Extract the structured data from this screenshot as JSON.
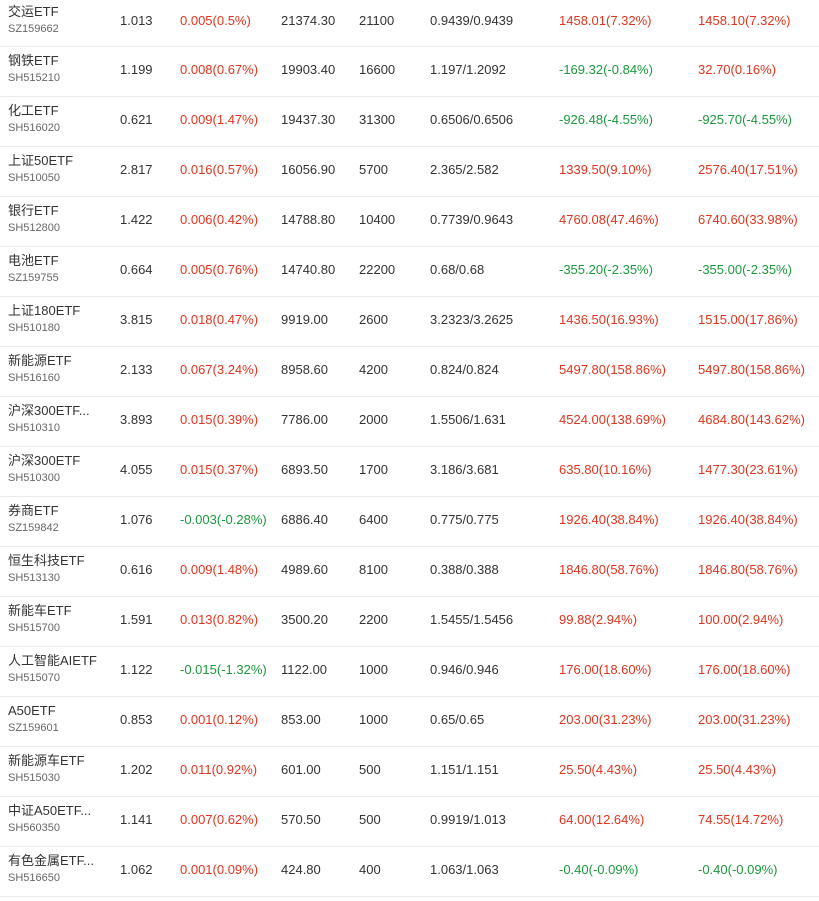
{
  "colors": {
    "up": "#e0341d",
    "down": "#1b9a3c",
    "text": "#333333",
    "sub_text": "#666666",
    "divider": "#ebebeb"
  },
  "rows": [
    {
      "name": "交运ETF",
      "code": "SZ159662",
      "price": "1.013",
      "change": "0.005(0.5%)",
      "change_dir": "up",
      "market_value": "21374.30",
      "quantity": "21100",
      "cost": "0.9439/0.9439",
      "pl_day": "1458.01(7.32%)",
      "pl_day_dir": "up",
      "pl_total": "1458.10(7.32%)",
      "pl_total_dir": "up"
    },
    {
      "name": "钢铁ETF",
      "code": "SH515210",
      "price": "1.199",
      "change": "0.008(0.67%)",
      "change_dir": "up",
      "market_value": "19903.40",
      "quantity": "16600",
      "cost": "1.197/1.2092",
      "pl_day": "-169.32(-0.84%)",
      "pl_day_dir": "down",
      "pl_total": "32.70(0.16%)",
      "pl_total_dir": "up"
    },
    {
      "name": "化工ETF",
      "code": "SH516020",
      "price": "0.621",
      "change": "0.009(1.47%)",
      "change_dir": "up",
      "market_value": "19437.30",
      "quantity": "31300",
      "cost": "0.6506/0.6506",
      "pl_day": "-926.48(-4.55%)",
      "pl_day_dir": "down",
      "pl_total": "-925.70(-4.55%)",
      "pl_total_dir": "down"
    },
    {
      "name": "上证50ETF",
      "code": "SH510050",
      "price": "2.817",
      "change": "0.016(0.57%)",
      "change_dir": "up",
      "market_value": "16056.90",
      "quantity": "5700",
      "cost": "2.365/2.582",
      "pl_day": "1339.50(9.10%)",
      "pl_day_dir": "up",
      "pl_total": "2576.40(17.51%)",
      "pl_total_dir": "up"
    },
    {
      "name": "银行ETF",
      "code": "SH512800",
      "price": "1.422",
      "change": "0.006(0.42%)",
      "change_dir": "up",
      "market_value": "14788.80",
      "quantity": "10400",
      "cost": "0.7739/0.9643",
      "pl_day": "4760.08(47.46%)",
      "pl_day_dir": "up",
      "pl_total": "6740.60(33.98%)",
      "pl_total_dir": "up"
    },
    {
      "name": "电池ETF",
      "code": "SZ159755",
      "price": "0.664",
      "change": "0.005(0.76%)",
      "change_dir": "up",
      "market_value": "14740.80",
      "quantity": "22200",
      "cost": "0.68/0.68",
      "pl_day": "-355.20(-2.35%)",
      "pl_day_dir": "down",
      "pl_total": "-355.00(-2.35%)",
      "pl_total_dir": "down"
    },
    {
      "name": "上证180ETF",
      "code": "SH510180",
      "price": "3.815",
      "change": "0.018(0.47%)",
      "change_dir": "up",
      "market_value": "9919.00",
      "quantity": "2600",
      "cost": "3.2323/3.2625",
      "pl_day": "1436.50(16.93%)",
      "pl_day_dir": "up",
      "pl_total": "1515.00(17.86%)",
      "pl_total_dir": "up"
    },
    {
      "name": "新能源ETF",
      "code": "SH516160",
      "price": "2.133",
      "change": "0.067(3.24%)",
      "change_dir": "up",
      "market_value": "8958.60",
      "quantity": "4200",
      "cost": "0.824/0.824",
      "pl_day": "5497.80(158.86%)",
      "pl_day_dir": "up",
      "pl_total": "5497.80(158.86%)",
      "pl_total_dir": "up"
    },
    {
      "name": "沪深300ETF...",
      "code": "SH510310",
      "price": "3.893",
      "change": "0.015(0.39%)",
      "change_dir": "up",
      "market_value": "7786.00",
      "quantity": "2000",
      "cost": "1.5506/1.631",
      "pl_day": "4524.00(138.69%)",
      "pl_day_dir": "up",
      "pl_total": "4684.80(143.62%)",
      "pl_total_dir": "up"
    },
    {
      "name": "沪深300ETF",
      "code": "SH510300",
      "price": "4.055",
      "change": "0.015(0.37%)",
      "change_dir": "up",
      "market_value": "6893.50",
      "quantity": "1700",
      "cost": "3.186/3.681",
      "pl_day": "635.80(10.16%)",
      "pl_day_dir": "up",
      "pl_total": "1477.30(23.61%)",
      "pl_total_dir": "up"
    },
    {
      "name": "券商ETF",
      "code": "SZ159842",
      "price": "1.076",
      "change": "-0.003(-0.28%)",
      "change_dir": "down",
      "market_value": "6886.40",
      "quantity": "6400",
      "cost": "0.775/0.775",
      "pl_day": "1926.40(38.84%)",
      "pl_day_dir": "up",
      "pl_total": "1926.40(38.84%)",
      "pl_total_dir": "up"
    },
    {
      "name": "恒生科技ETF",
      "code": "SH513130",
      "price": "0.616",
      "change": "0.009(1.48%)",
      "change_dir": "up",
      "market_value": "4989.60",
      "quantity": "8100",
      "cost": "0.388/0.388",
      "pl_day": "1846.80(58.76%)",
      "pl_day_dir": "up",
      "pl_total": "1846.80(58.76%)",
      "pl_total_dir": "up"
    },
    {
      "name": "新能车ETF",
      "code": "SH515700",
      "price": "1.591",
      "change": "0.013(0.82%)",
      "change_dir": "up",
      "market_value": "3500.20",
      "quantity": "2200",
      "cost": "1.5455/1.5456",
      "pl_day": "99.88(2.94%)",
      "pl_day_dir": "up",
      "pl_total": "100.00(2.94%)",
      "pl_total_dir": "up"
    },
    {
      "name": "人工智能AIETF",
      "code": "SH515070",
      "price": "1.122",
      "change": "-0.015(-1.32%)",
      "change_dir": "down",
      "market_value": "1122.00",
      "quantity": "1000",
      "cost": "0.946/0.946",
      "pl_day": "176.00(18.60%)",
      "pl_day_dir": "up",
      "pl_total": "176.00(18.60%)",
      "pl_total_dir": "up"
    },
    {
      "name": "A50ETF",
      "code": "SZ159601",
      "price": "0.853",
      "change": "0.001(0.12%)",
      "change_dir": "up",
      "market_value": "853.00",
      "quantity": "1000",
      "cost": "0.65/0.65",
      "pl_day": "203.00(31.23%)",
      "pl_day_dir": "up",
      "pl_total": "203.00(31.23%)",
      "pl_total_dir": "up"
    },
    {
      "name": "新能源车ETF",
      "code": "SH515030",
      "price": "1.202",
      "change": "0.011(0.92%)",
      "change_dir": "up",
      "market_value": "601.00",
      "quantity": "500",
      "cost": "1.151/1.151",
      "pl_day": "25.50(4.43%)",
      "pl_day_dir": "up",
      "pl_total": "25.50(4.43%)",
      "pl_total_dir": "up"
    },
    {
      "name": "中证A50ETF...",
      "code": "SH560350",
      "price": "1.141",
      "change": "0.007(0.62%)",
      "change_dir": "up",
      "market_value": "570.50",
      "quantity": "500",
      "cost": "0.9919/1.013",
      "pl_day": "64.00(12.64%)",
      "pl_day_dir": "up",
      "pl_total": "74.55(14.72%)",
      "pl_total_dir": "up"
    },
    {
      "name": "有色金属ETF...",
      "code": "SH516650",
      "price": "1.062",
      "change": "0.001(0.09%)",
      "change_dir": "up",
      "market_value": "424.80",
      "quantity": "400",
      "cost": "1.063/1.063",
      "pl_day": "-0.40(-0.09%)",
      "pl_day_dir": "down",
      "pl_total": "-0.40(-0.09%)",
      "pl_total_dir": "down"
    }
  ]
}
